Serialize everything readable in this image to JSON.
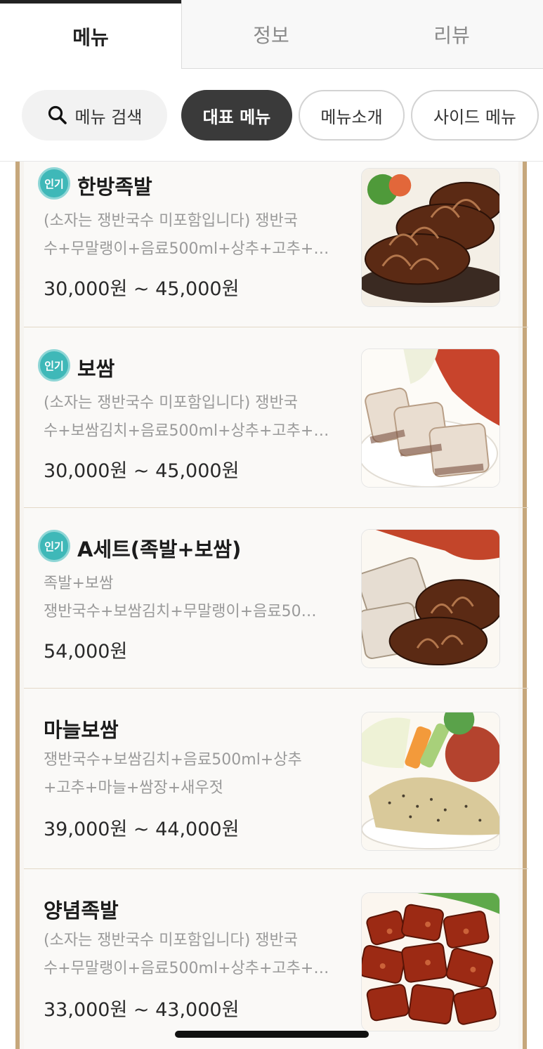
{
  "tabs": [
    {
      "label": "메뉴",
      "active": true
    },
    {
      "label": "정보",
      "active": false
    },
    {
      "label": "리뷰",
      "active": false
    }
  ],
  "chips": {
    "search": "메뉴 검색",
    "representative": "대표 메뉴",
    "intro": "메뉴소개",
    "side": "사이드 메뉴"
  },
  "badge_label": "인기",
  "colors": {
    "accent_badge": "#3fb8b8",
    "frame_border": "#c6a77c",
    "active_chip": "#3a3a3a"
  },
  "menu_items": [
    {
      "title": "한방족발",
      "popular": true,
      "desc_lines": [
        "(소자는 쟁반국수 미포함입니다) 쟁반국",
        "수+무말랭이+음료500ml+상추+고추+…"
      ],
      "price": "30,000원 ~ 45,000원",
      "image": "jokbal-photo"
    },
    {
      "title": "보쌈",
      "popular": true,
      "desc_lines": [
        "(소자는 쟁반국수 미포함입니다) 쟁반국",
        "수+보쌈김치+음료500ml+상추+고추+…"
      ],
      "price": "30,000원 ~ 45,000원",
      "image": "bossam-photo"
    },
    {
      "title": "A세트(족발+보쌈)",
      "popular": true,
      "desc_lines": [
        "족발+보쌈",
        "쟁반국수+보쌈김치+무말랭이+음료50…"
      ],
      "price": "54,000원",
      "image": "set-photo"
    },
    {
      "title": "마늘보쌈",
      "popular": false,
      "desc_lines": [
        "쟁반국수+보쌈김치+음료500ml+상추",
        "+고추+마늘+쌈장+새우젓"
      ],
      "price": "39,000원 ~ 44,000원",
      "image": "garlic-bossam-photo"
    },
    {
      "title": "양념족발",
      "popular": false,
      "desc_lines": [
        "(소자는 쟁반국수 미포함입니다) 쟁반국",
        "수+무말랭이+음료500ml+상추+고추+…"
      ],
      "price": "33,000원 ~ 43,000원",
      "image": "spicy-jokbal-photo"
    }
  ]
}
